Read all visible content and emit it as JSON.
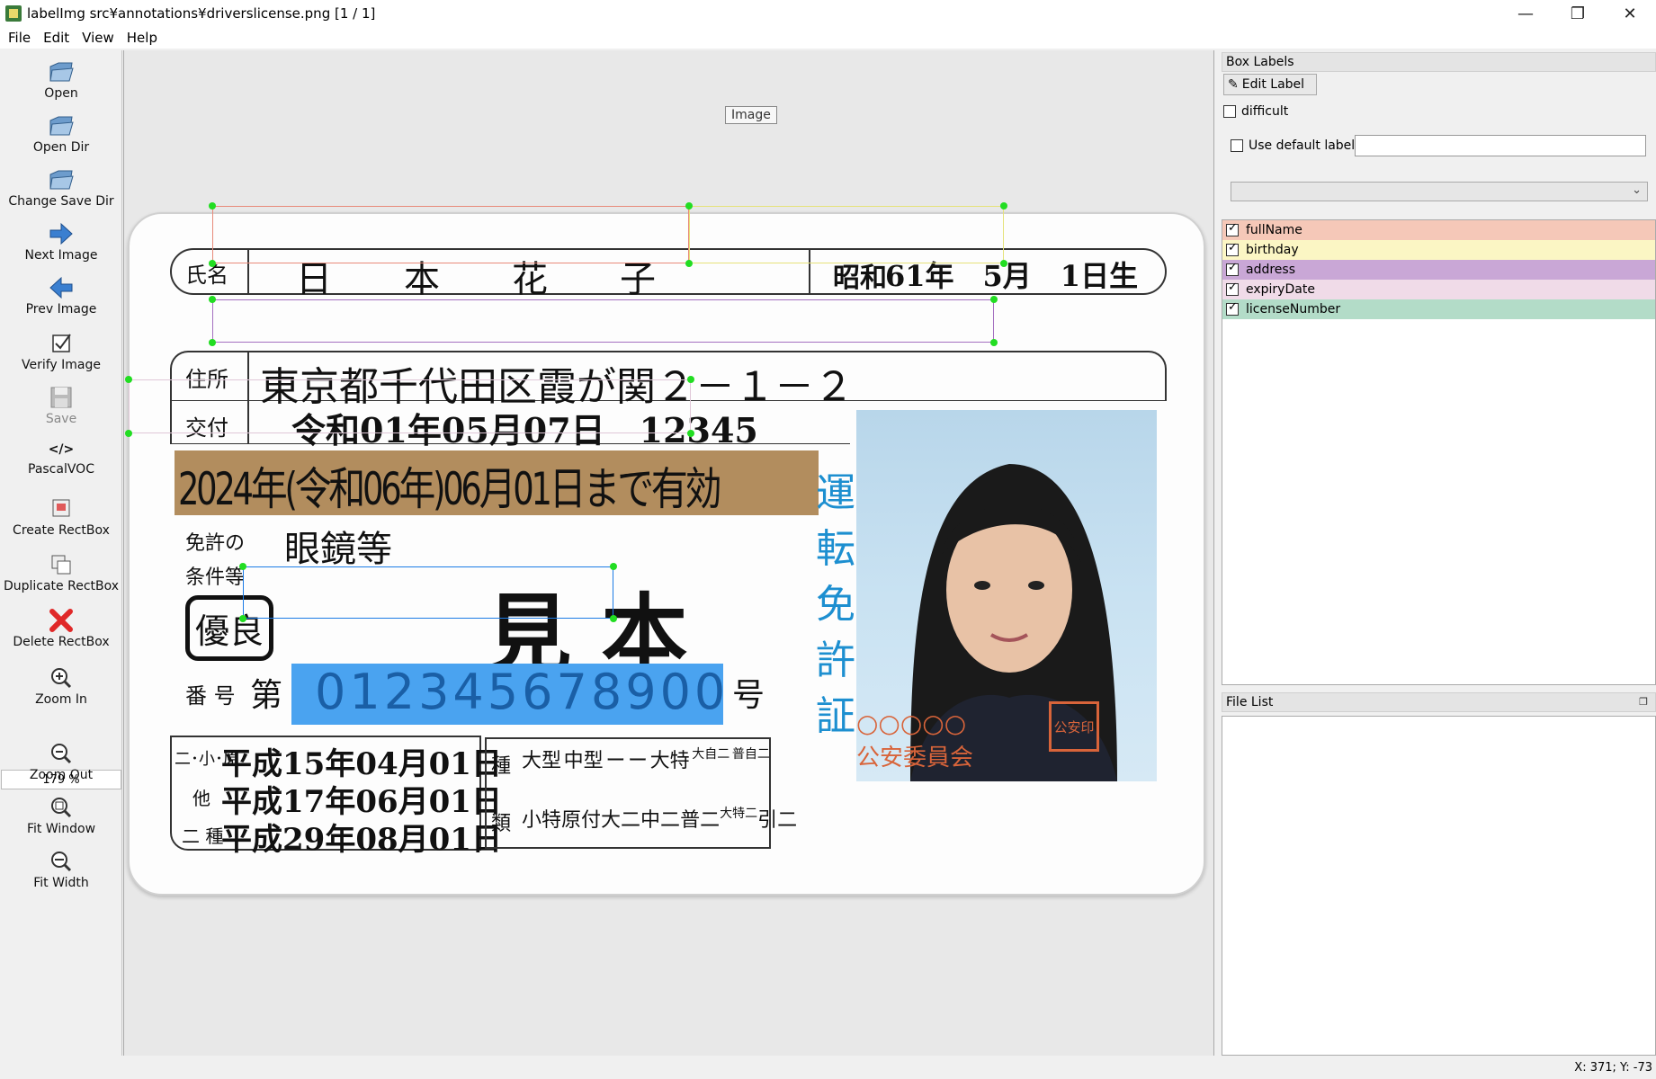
{
  "window": {
    "title": "labelImg src¥annotations¥driverslicense.png [1 / 1]",
    "minimize": "—",
    "restore": "❐",
    "close": "✕"
  },
  "menu": [
    "File",
    "Edit",
    "View",
    "Help"
  ],
  "toolbar": {
    "open": "Open",
    "open_dir": "Open Dir",
    "change_save_dir": "Change Save Dir",
    "next_image": "Next Image",
    "prev_image": "Prev Image",
    "verify_image": "Verify Image",
    "save": "Save",
    "format": "PascalVOC",
    "format_icon": "</>",
    "create_rectbox": "Create RectBox",
    "duplicate_rectbox": "Duplicate RectBox",
    "delete_rectbox": "Delete RectBox",
    "zoom_in": "Zoom In",
    "zoom_value": "179 %",
    "zoom_out": "Zoom Out",
    "fit_window": "Fit Window",
    "fit_width": "Fit Width"
  },
  "canvas": {
    "image_tag": "Image"
  },
  "license": {
    "name_label": "氏名",
    "name_value": "日　　本　　花　　子",
    "birth_era": "昭和",
    "birth_date": "61年　5月　1日生",
    "address_label": "住所",
    "address_value": "東京都千代田区霞が関２－１－２",
    "issue_label": "交付",
    "issue_value": "令和01年05月07日　12345",
    "expiry_value": "2024年(令和06年)06月01日まで有効",
    "conditions_label_1": "免許の",
    "conditions_label_2": "条件等",
    "conditions_value": "眼鏡等",
    "sample_mark": "見 本",
    "excellent": "優良",
    "number_label": "番 号",
    "number_prefix": "第",
    "number_value": "012345678900",
    "number_suffix": "号",
    "class_rows": [
      {
        "label": "二･小･原",
        "date": "平成15年04月01日"
      },
      {
        "label": "他",
        "date": "平成17年06月01日"
      },
      {
        "label": "二 種",
        "date": "平成29年08月01日"
      }
    ],
    "kind_label_top": "種",
    "kind_label_bottom": "類",
    "kinds_top": [
      "大型",
      "中型",
      "ー",
      "ー",
      "大特",
      "大自二",
      "普自二"
    ],
    "kinds_bottom": [
      "小特",
      "原付",
      "大二",
      "中二",
      "普二",
      "大特二",
      "引二"
    ],
    "vertical_title": [
      "運",
      "転",
      "免",
      "許",
      "証"
    ],
    "commission_marks": "○○○○○",
    "commission": "公安委員会",
    "seal": "公安印"
  },
  "right_panel": {
    "box_labels_title": "Box Labels",
    "edit_label_button": "Edit Label",
    "difficult": "difficult",
    "use_default_label": "Use default label",
    "default_label_value": "",
    "labels": [
      {
        "name": "fullName",
        "color": "#f5c8b8",
        "checked": true
      },
      {
        "name": "birthday",
        "color": "#fbf6c4",
        "checked": true
      },
      {
        "name": "address",
        "color": "#c9a7d6",
        "checked": true
      },
      {
        "name": "expiryDate",
        "color": "#f0dbe8",
        "checked": true
      },
      {
        "name": "licenseNumber",
        "color": "#b3dcc8",
        "checked": true
      }
    ],
    "file_list_title": "File List"
  },
  "status": {
    "coords": "X: 371; Y: -73"
  }
}
